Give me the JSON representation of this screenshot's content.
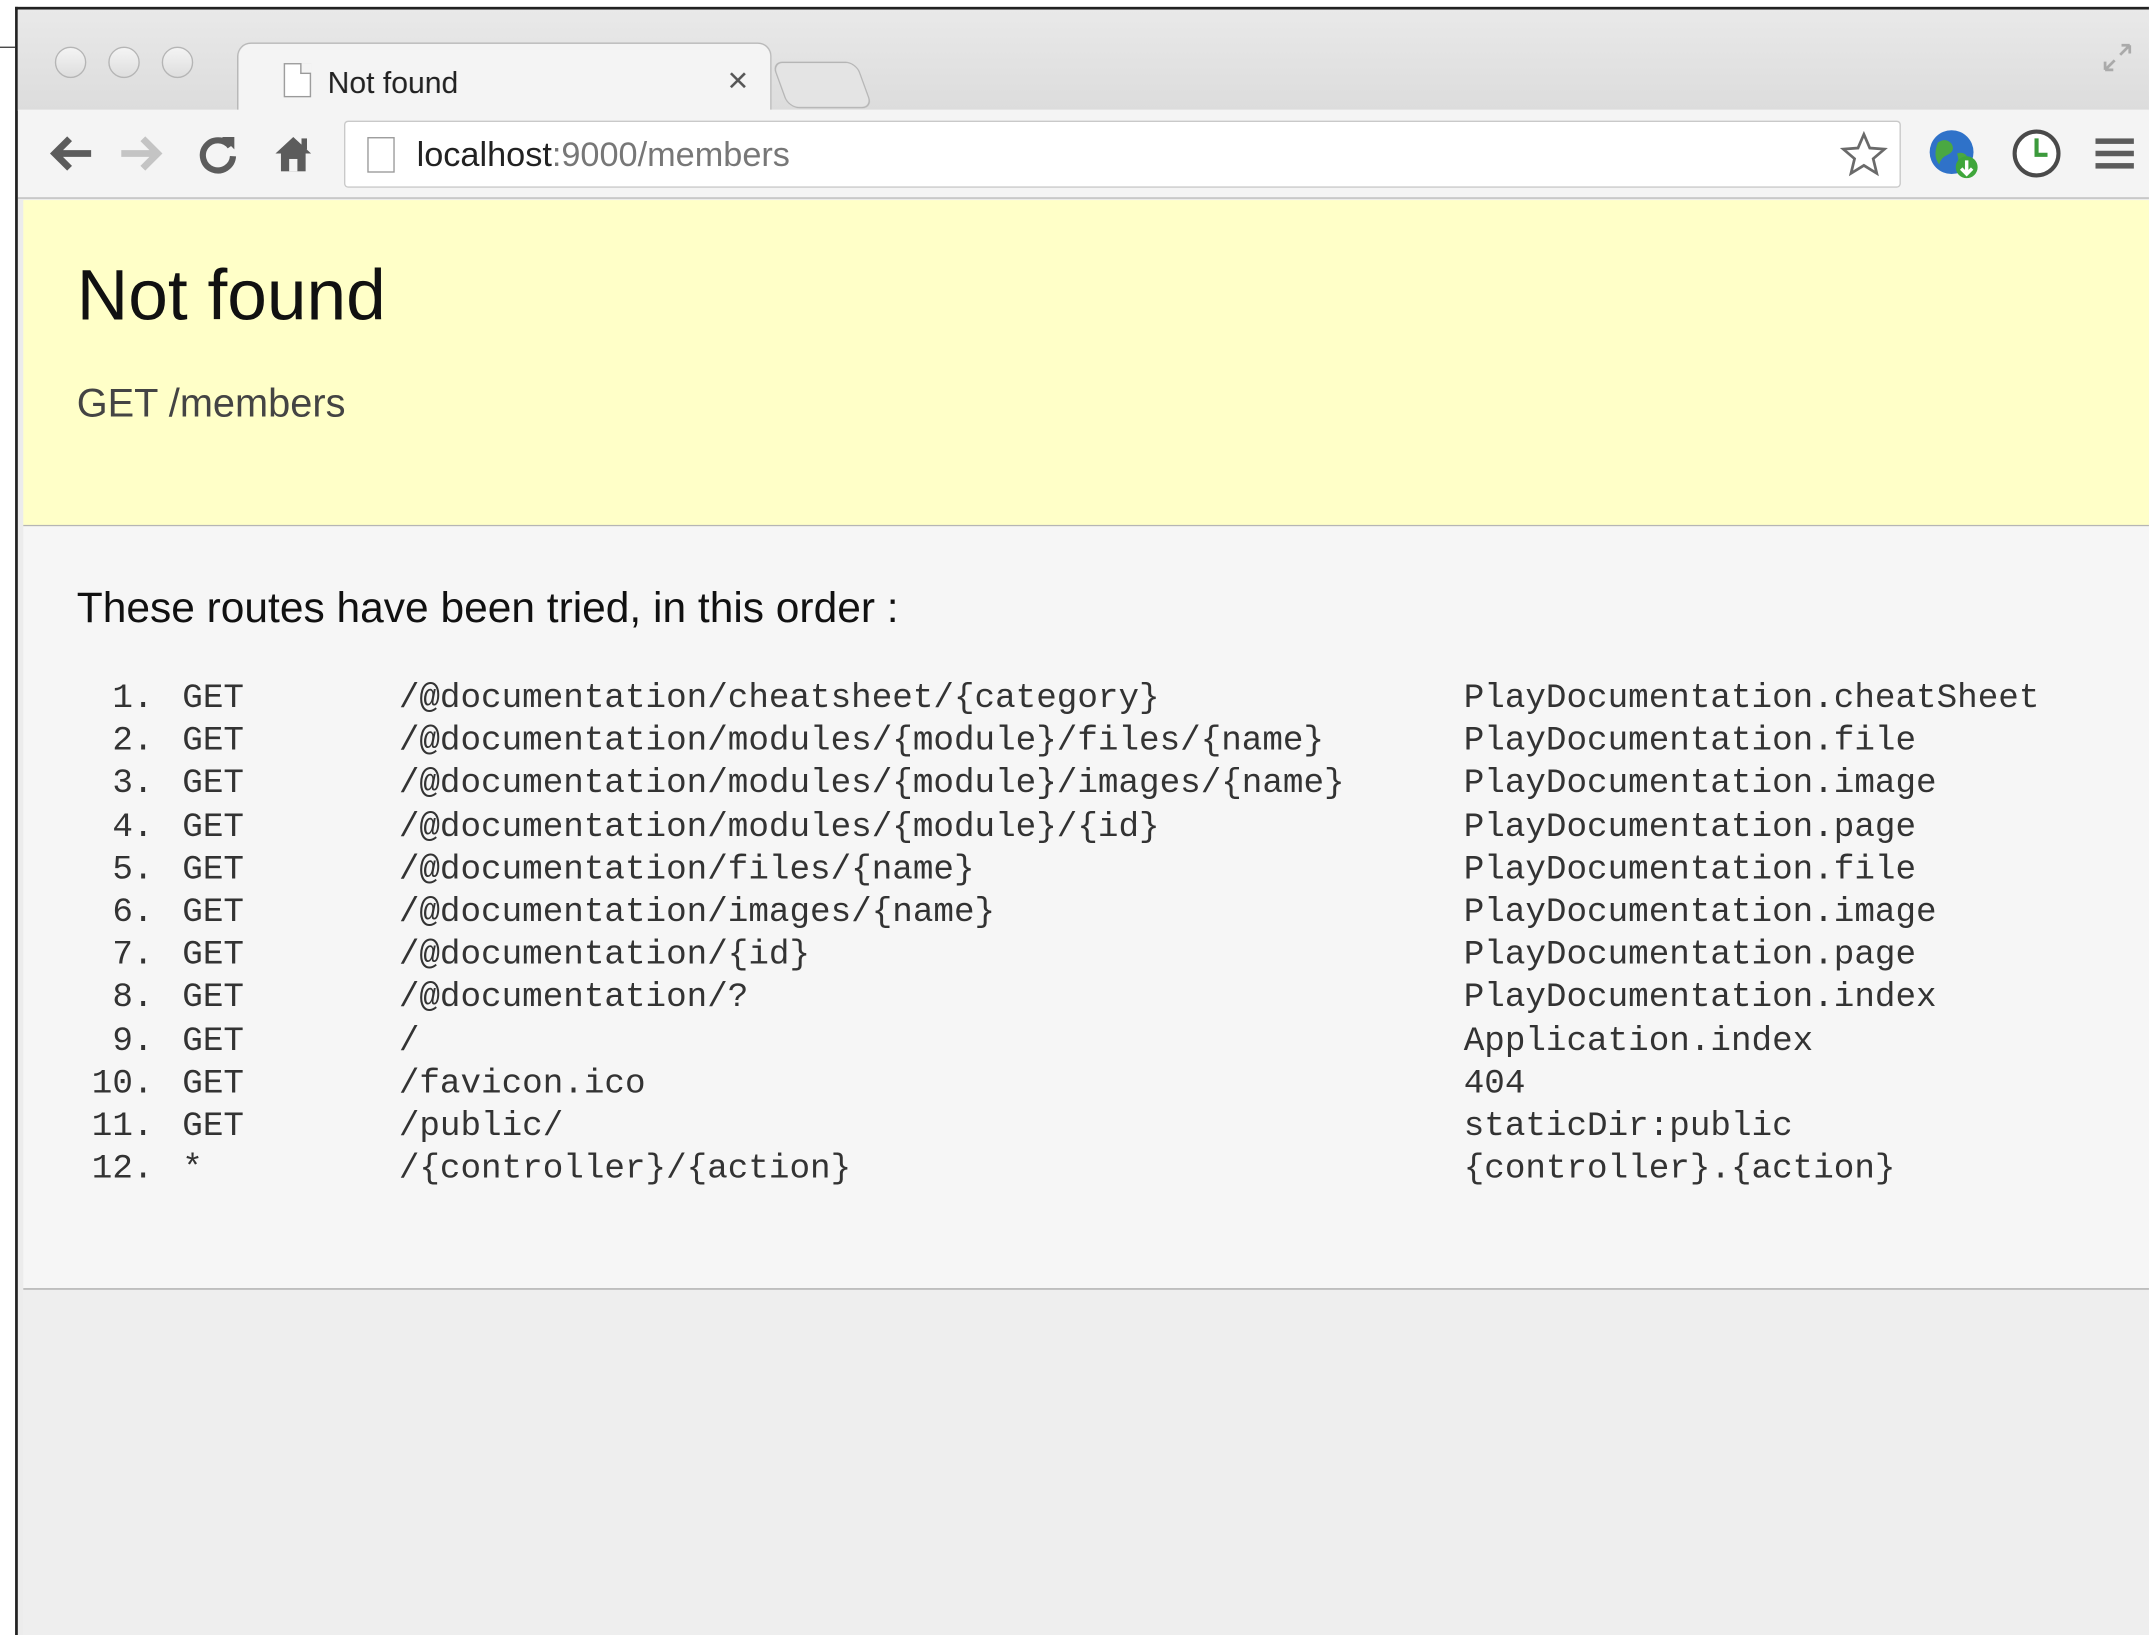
{
  "browser": {
    "tab_title": "Not found",
    "tab_close_glyph": "×",
    "address": {
      "host": "localhost",
      "rest": ":9000/members"
    },
    "icons": [
      "back-arrow-icon",
      "forward-arrow-icon",
      "reload-icon",
      "home-icon",
      "page-icon",
      "star-icon",
      "globe-extension-icon",
      "clock-extension-icon",
      "menu-icon",
      "fullscreen-icon"
    ]
  },
  "error": {
    "title": "Not found",
    "request": "GET /members"
  },
  "routes": {
    "heading": "These routes have been tried, in this order :",
    "rows": [
      {
        "num": "1.",
        "method": "GET",
        "path": "/@documentation/cheatsheet/{category}",
        "action": "PlayDocumentation.cheatSheet"
      },
      {
        "num": "2.",
        "method": "GET",
        "path": "/@documentation/modules/{module}/files/{name}",
        "action": "PlayDocumentation.file"
      },
      {
        "num": "3.",
        "method": "GET",
        "path": "/@documentation/modules/{module}/images/{name}",
        "action": "PlayDocumentation.image"
      },
      {
        "num": "4.",
        "method": "GET",
        "path": "/@documentation/modules/{module}/{id}",
        "action": "PlayDocumentation.page"
      },
      {
        "num": "5.",
        "method": "GET",
        "path": "/@documentation/files/{name}",
        "action": "PlayDocumentation.file"
      },
      {
        "num": "6.",
        "method": "GET",
        "path": "/@documentation/images/{name}",
        "action": "PlayDocumentation.image"
      },
      {
        "num": "7.",
        "method": "GET",
        "path": "/@documentation/{id}",
        "action": "PlayDocumentation.page"
      },
      {
        "num": "8.",
        "method": "GET",
        "path": "/@documentation/?",
        "action": "PlayDocumentation.index"
      },
      {
        "num": "9.",
        "method": "GET",
        "path": "/",
        "action": "Application.index"
      },
      {
        "num": "10.",
        "method": "GET",
        "path": "/favicon.ico",
        "action": "404"
      },
      {
        "num": "11.",
        "method": "GET",
        "path": "/public/",
        "action": "staticDir:public"
      },
      {
        "num": "12.",
        "method": "*",
        "path": "/{controller}/{action}",
        "action": "{controller}.{action}"
      }
    ]
  },
  "colors": {
    "notfound_bg": "#ffffc8",
    "routes_bg": "#f6f6f6",
    "page_bg": "#eeeeee"
  }
}
